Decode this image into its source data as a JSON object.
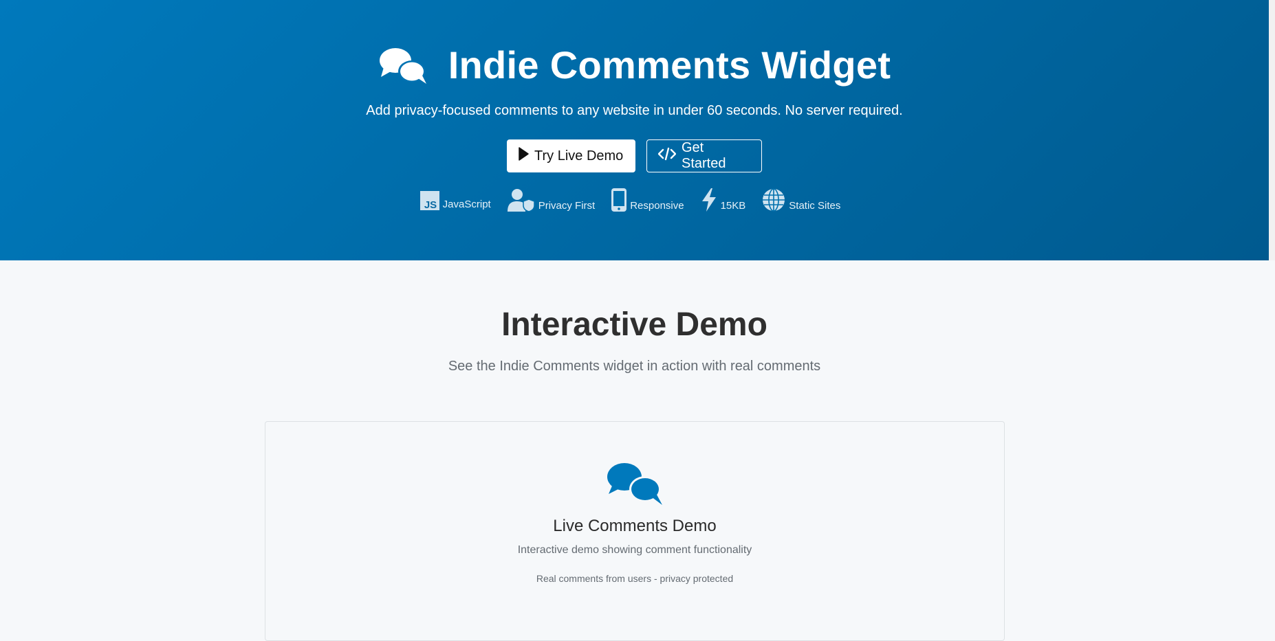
{
  "hero": {
    "title": "Indie Comments Widget",
    "logo_icon": "comments-icon",
    "tagline": "Add privacy-focused comments to any website in under 60 seconds. No server required.",
    "primary_button": {
      "label": "Try Live Demo",
      "icon": "play-icon"
    },
    "secondary_button": {
      "label": "Get Started",
      "icon": "code-icon"
    },
    "features": [
      {
        "label": "JavaScript",
        "icon": "javascript-icon"
      },
      {
        "label": "Privacy First",
        "icon": "user-shield-icon"
      },
      {
        "label": "Responsive",
        "icon": "mobile-icon"
      },
      {
        "label": "15KB",
        "icon": "bolt-icon"
      },
      {
        "label": "Static Sites",
        "icon": "globe-icon"
      }
    ],
    "colors": {
      "gradient_start": "#0079bc",
      "gradient_end": "#005a8f"
    }
  },
  "demo": {
    "heading": "Interactive Demo",
    "subheading": "See the Indie Comments widget in action with real comments",
    "card": {
      "icon": "comments-icon",
      "title": "Live Comments Demo",
      "description": "Interactive demo showing comment functionality",
      "note": "Real comments from users - privacy protected",
      "accent_color": "#0079bc"
    }
  }
}
